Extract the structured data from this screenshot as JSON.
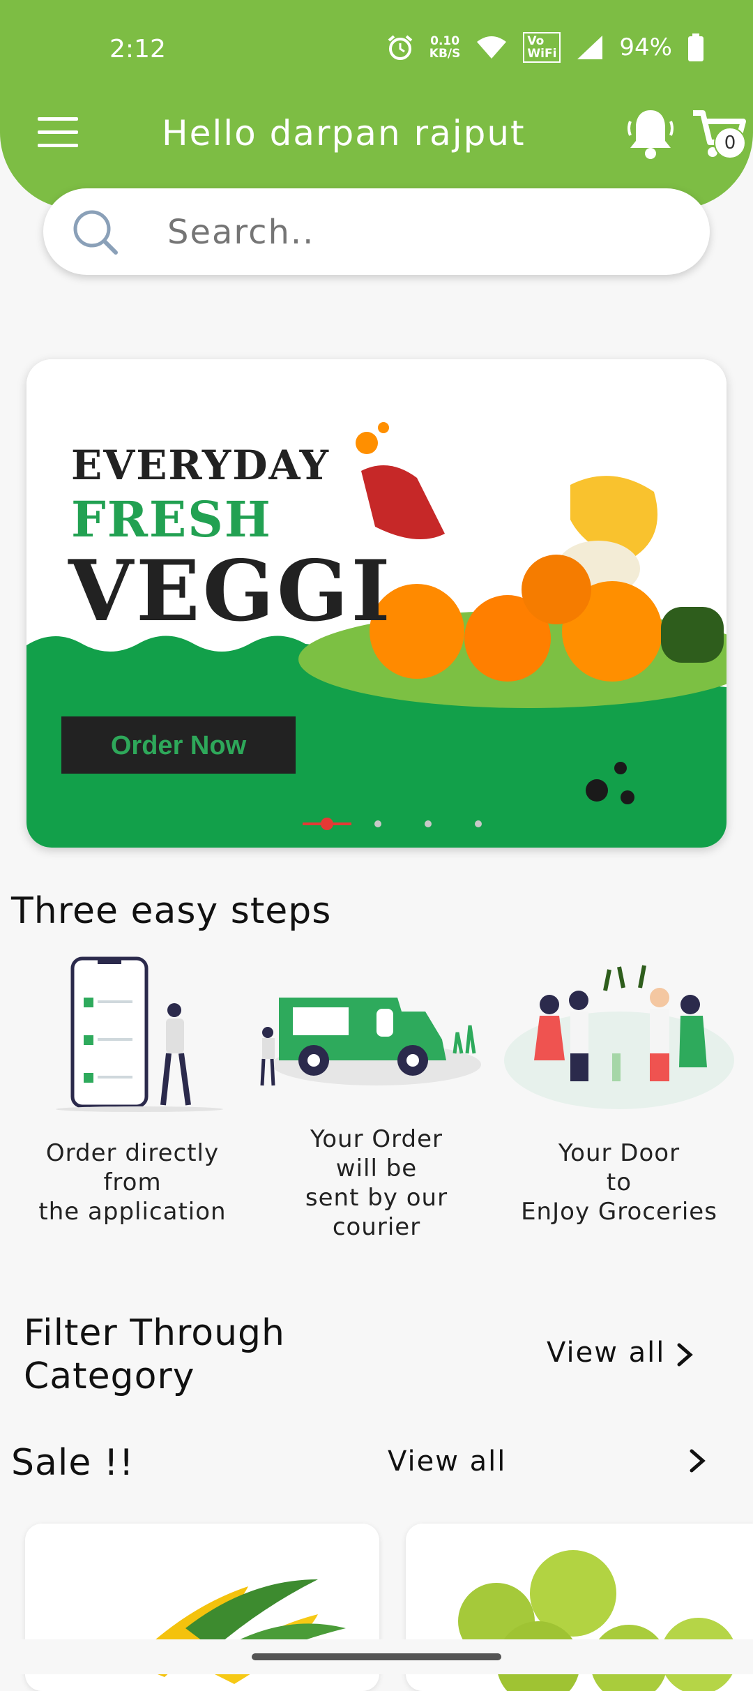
{
  "status": {
    "time": "2:12",
    "net_speed": "0.10\nKB/S",
    "volte": "Vo\nWiFi",
    "battery": "94%"
  },
  "header": {
    "greeting": "Hello darpan rajput",
    "cart_count": "0"
  },
  "search": {
    "placeholder": "Search.."
  },
  "banner": {
    "line1": "EVERYDAY",
    "line2": "FRESH",
    "line3": "VEGGI",
    "button": "Order Now",
    "active_slide": 1,
    "slide_count": 4
  },
  "steps_section": {
    "title": "Three easy steps",
    "steps": [
      {
        "caption": "Order directly\nfrom\nthe application"
      },
      {
        "caption": "Your Order\nwill be\nsent by our\ncourier"
      },
      {
        "caption": "Your Door\nto\nEnJoy Groceries"
      }
    ]
  },
  "category_section": {
    "title": "Filter Through\nCategory",
    "view_all": "View all"
  },
  "sale_section": {
    "title": "Sale !!",
    "view_all": "View all"
  },
  "colors": {
    "brand_green": "#7dbd44",
    "banner_green": "#12a04a",
    "dot_active": "#e53935"
  }
}
